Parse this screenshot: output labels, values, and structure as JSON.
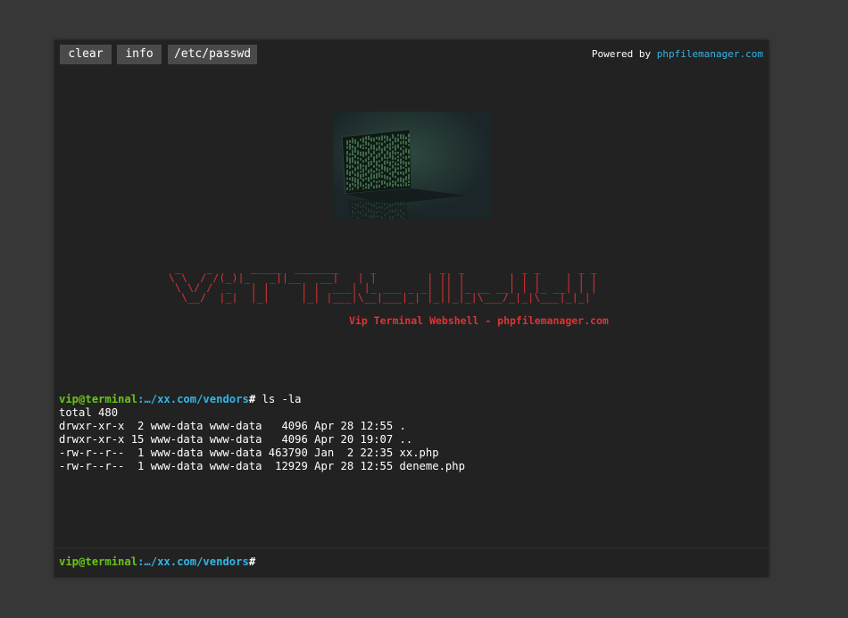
{
  "toolbar": {
    "buttons": [
      {
        "label": "clear"
      },
      {
        "label": "info"
      },
      {
        "label": "/etc/passwd"
      }
    ],
    "powered_prefix": "Powered by ",
    "powered_link": "phpfilemanager.com"
  },
  "banner": {
    "ascii_lines": [
      " _    _      _____  _______     _          _  _         _ _      _ _",
      "\\ \\  / /(_)|_   _||__   __|   | |        | || |       | | |    | | |",
      " \\ \\/ /  _   | |     | |  ___| |_ ___ _ _| || |_ __ __| | |_ __| | |",
      "  \\__/  |_|  |_|     |_| |___|\\__|___|_| |_||_|_|\\___/_|_|\\___|_|_|"
    ],
    "subtitle": "Vip Terminal Webshell - phpfilemanager.com"
  },
  "session": {
    "user": "vip",
    "host": "@terminal",
    "path": ":…/xx.com/vendors",
    "hash": "#",
    "command": " ls -la",
    "output": [
      "total 480",
      "drwxr-xr-x  2 www-data www-data   4096 Apr 28 12:55 .",
      "drwxr-xr-x 15 www-data www-data   4096 Apr 20 19:07 ..",
      "-rw-r--r--  1 www-data www-data 463790 Jan  2 22:35 xx.php",
      "-rw-r--r--  1 www-data www-data  12929 Apr 28 12:55 deneme.php"
    ]
  },
  "input": {
    "value": ""
  },
  "colors": {
    "background": "#373737",
    "terminal": "#222222",
    "prompt_user": "#69c41b",
    "prompt_path": "#33b5e5",
    "banner": "#e03333"
  }
}
